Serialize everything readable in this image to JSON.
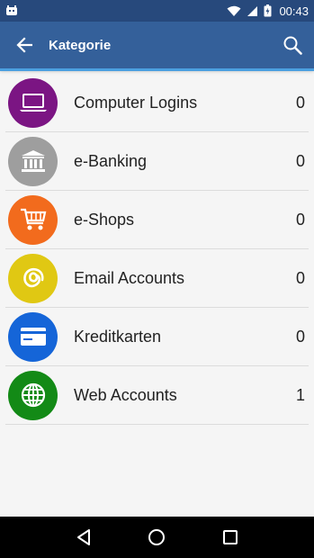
{
  "status_bar": {
    "time": "00:43"
  },
  "app_bar": {
    "title": "Kategorie"
  },
  "categories": [
    {
      "label": "Computer Logins",
      "count": "0",
      "color": "#7b1583",
      "icon": "laptop-icon"
    },
    {
      "label": "e-Banking",
      "count": "0",
      "color": "#9e9e9e",
      "icon": "bank-icon"
    },
    {
      "label": "e-Shops",
      "count": "0",
      "color": "#f26b1d",
      "icon": "shopping-cart-icon"
    },
    {
      "label": "Email Accounts",
      "count": "0",
      "color": "#e0c813",
      "icon": "email-at-icon"
    },
    {
      "label": "Kreditkarten",
      "count": "0",
      "color": "#1565d8",
      "icon": "credit-card-icon"
    },
    {
      "label": "Web Accounts",
      "count": "1",
      "color": "#138a16",
      "icon": "globe-icon"
    }
  ]
}
